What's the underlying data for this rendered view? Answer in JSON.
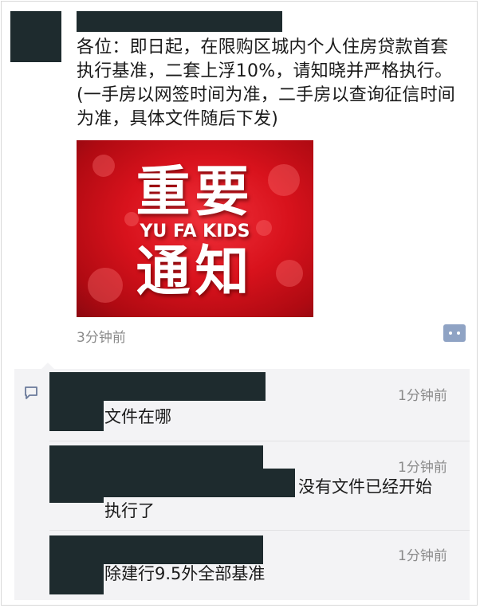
{
  "post": {
    "text": "各位：即日起，在限购区城内个人住房贷款首套执行基准，二套上浮10%，请知晓并严格执行。(一手房以网签时间为准，二手房以查询征信时间为准，具体文件随后下发)",
    "image": {
      "title_top": "重要",
      "subtitle": "YU FA KIDS",
      "title_bottom": "通知",
      "color": "#d8121c"
    },
    "time": "3分钟前",
    "more_icon": "more-dots-icon"
  },
  "comments": {
    "icon": "comment-icon",
    "items": [
      {
        "text": "文件在哪",
        "time": "1分钟前"
      },
      {
        "text_line1": "没有文件已经开始",
        "text_line2": "执行了",
        "time": "1分钟前"
      },
      {
        "text": "除建行9.5外全部基准",
        "time": "1分钟前"
      }
    ]
  },
  "colors": {
    "redaction": "#1e2b2e",
    "comment_bg": "#f3f3f5",
    "muted_text": "#8a8a8a",
    "more_button": "#8fa3c4"
  }
}
